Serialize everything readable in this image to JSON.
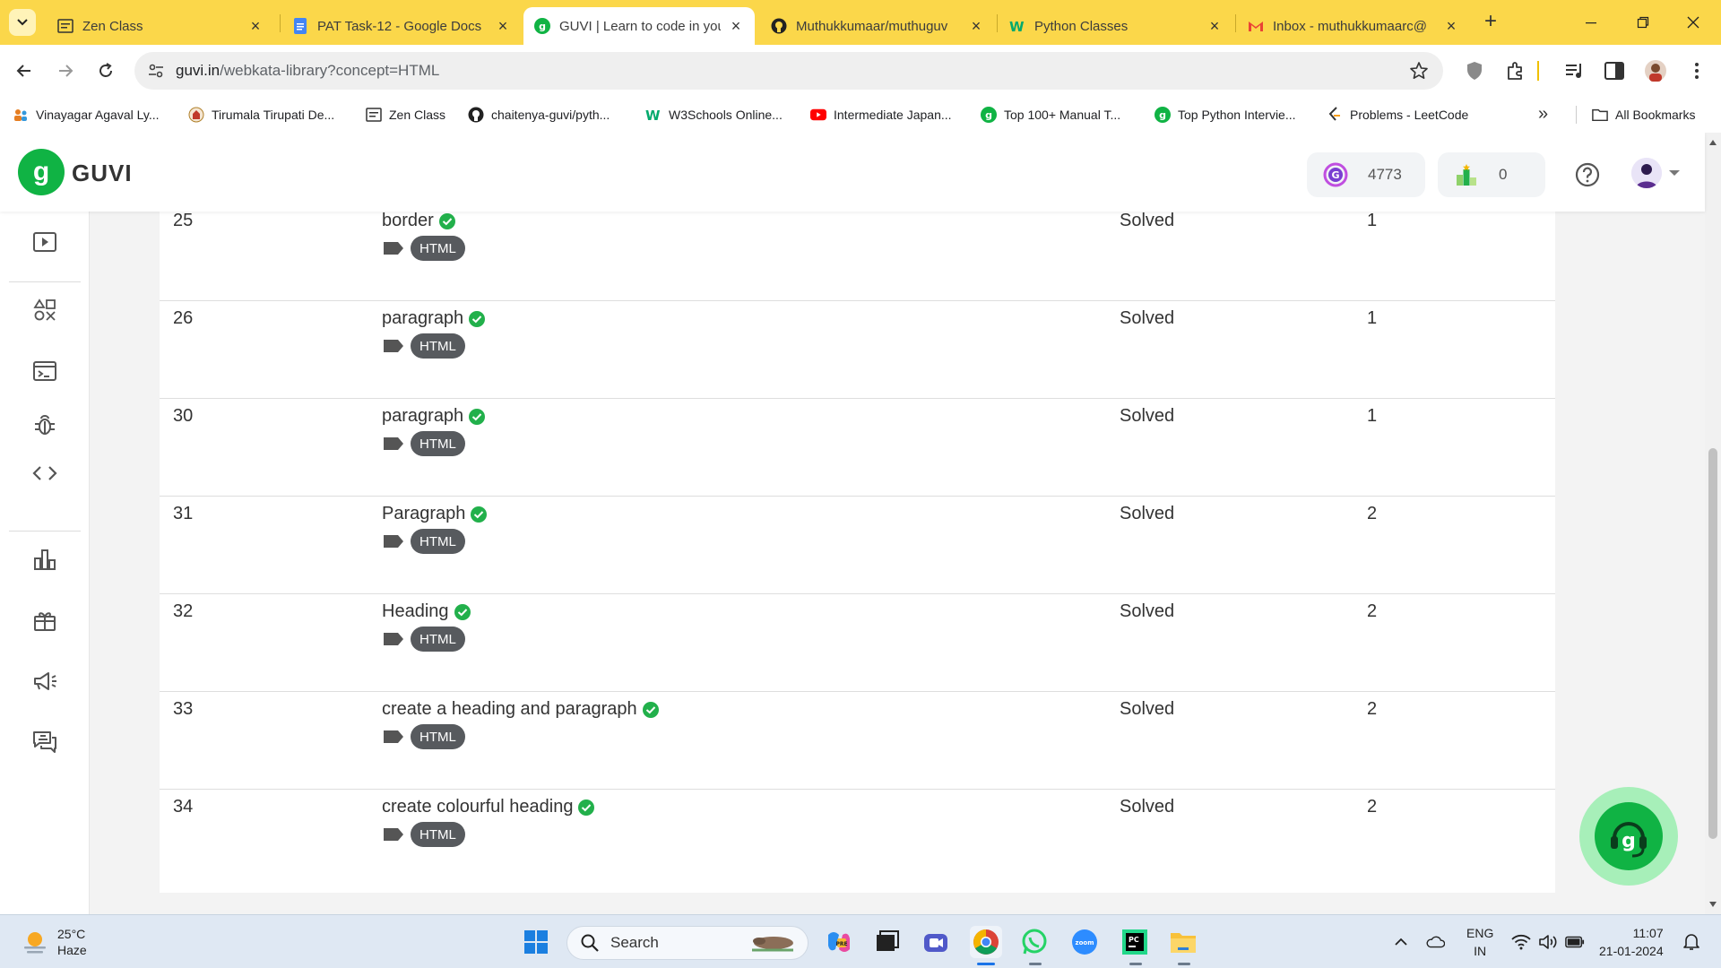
{
  "browser": {
    "tabs": [
      {
        "title": "Zen Class",
        "icon": "zen-class-favicon",
        "active": false
      },
      {
        "title": "PAT Task-12 - Google Docs",
        "icon": "google-docs-favicon",
        "active": false
      },
      {
        "title": "GUVI | Learn to code in you",
        "icon": "guvi-favicon",
        "active": true
      },
      {
        "title": "Muthukkumaar/muthuguv",
        "icon": "github-favicon",
        "active": false
      },
      {
        "title": "Python Classes",
        "icon": "w3schools-favicon",
        "active": false
      },
      {
        "title": "Inbox - muthukkumaarc@",
        "icon": "gmail-favicon",
        "active": false
      }
    ],
    "new_tab": "+",
    "tab_close": "×",
    "url_domain": "guvi.in",
    "url_path": "/webkata-library?concept=HTML",
    "bookmarks": [
      {
        "label": "Vinayagar Agaval Ly...",
        "icon": "people-icon"
      },
      {
        "label": "Tirumala Tirupati De...",
        "icon": "temple-icon"
      },
      {
        "label": "Zen Class",
        "icon": "zen-class-icon"
      },
      {
        "label": "chaitenya-guvi/pyth...",
        "icon": "github-icon"
      },
      {
        "label": "W3Schools Online...",
        "icon": "w3schools-icon"
      },
      {
        "label": "Intermediate Japan...",
        "icon": "youtube-icon"
      },
      {
        "label": "Top 100+ Manual T...",
        "icon": "guvi-icon"
      },
      {
        "label": "Top Python Intervie...",
        "icon": "guvi-icon"
      },
      {
        "label": "Problems - LeetCode",
        "icon": "leetcode-icon"
      }
    ],
    "bookmarks_more": "»",
    "all_bookmarks": "All Bookmarks"
  },
  "header": {
    "logo_text": "GUVI",
    "geekoins": "4773",
    "rank": "0"
  },
  "problems": [
    {
      "id": "25",
      "name": "border",
      "tag": "HTML",
      "status": "Solved",
      "level": "1"
    },
    {
      "id": "26",
      "name": "paragraph",
      "tag": "HTML",
      "status": "Solved",
      "level": "1"
    },
    {
      "id": "30",
      "name": "paragraph",
      "tag": "HTML",
      "status": "Solved",
      "level": "1"
    },
    {
      "id": "31",
      "name": "Paragraph",
      "tag": "HTML",
      "status": "Solved",
      "level": "2"
    },
    {
      "id": "32",
      "name": "Heading",
      "tag": "HTML",
      "status": "Solved",
      "level": "2"
    },
    {
      "id": "33",
      "name": "create a heading and paragraph",
      "tag": "HTML",
      "status": "Solved",
      "level": "2"
    },
    {
      "id": "34",
      "name": "create colourful heading",
      "tag": "HTML",
      "status": "Solved",
      "level": "2"
    }
  ],
  "taskbar": {
    "temperature": "25°C",
    "weather": "Haze",
    "search_label": "Search",
    "lang_top": "ENG",
    "lang_bottom": "IN",
    "time": "11:07",
    "date": "21-01-2024"
  },
  "colors": {
    "tabstrip": "#fbd74a",
    "guvi_green": "#10b344",
    "tag_bg": "#575a5e",
    "check_green": "#22b04b"
  }
}
